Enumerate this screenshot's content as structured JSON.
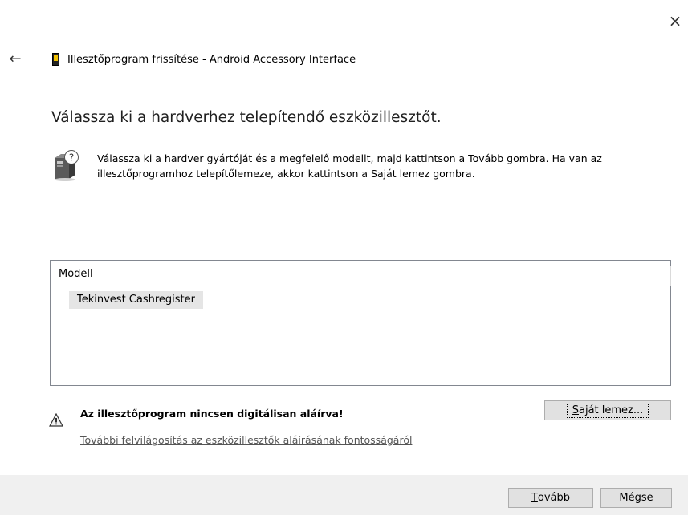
{
  "window": {
    "close_glyph": "×",
    "back_glyph": "←",
    "title": "Illesztőprogram frissítése - Android Accessory Interface"
  },
  "main": {
    "heading": "Válassza ki a hardverhez telepítendő eszközillesztőt.",
    "description": "Válassza ki a hardver gyártóját és a megfelelő modellt, majd kattintson a Tovább gombra. Ha van az illesztőprogramhoz telepítőlemeze, akkor kattintson a Saját lemez gombra."
  },
  "model_list": {
    "header": "Modell",
    "items": [
      "Tekinvest Cashregister"
    ]
  },
  "warning": {
    "text": "Az illesztőprogram nincsen digitálisan aláírva!",
    "link": "További felvilágosítás az eszközillesztők aláírásának fontosságáról"
  },
  "buttons": {
    "have_disk": {
      "mnemonic": "S",
      "rest": "aját lemez..."
    },
    "next": {
      "mnemonic": "T",
      "rest": "ovább"
    },
    "cancel": "Mégse"
  },
  "icons": {
    "device": "device-icon",
    "help": "hardware-help-icon",
    "warning": "warning-icon"
  }
}
